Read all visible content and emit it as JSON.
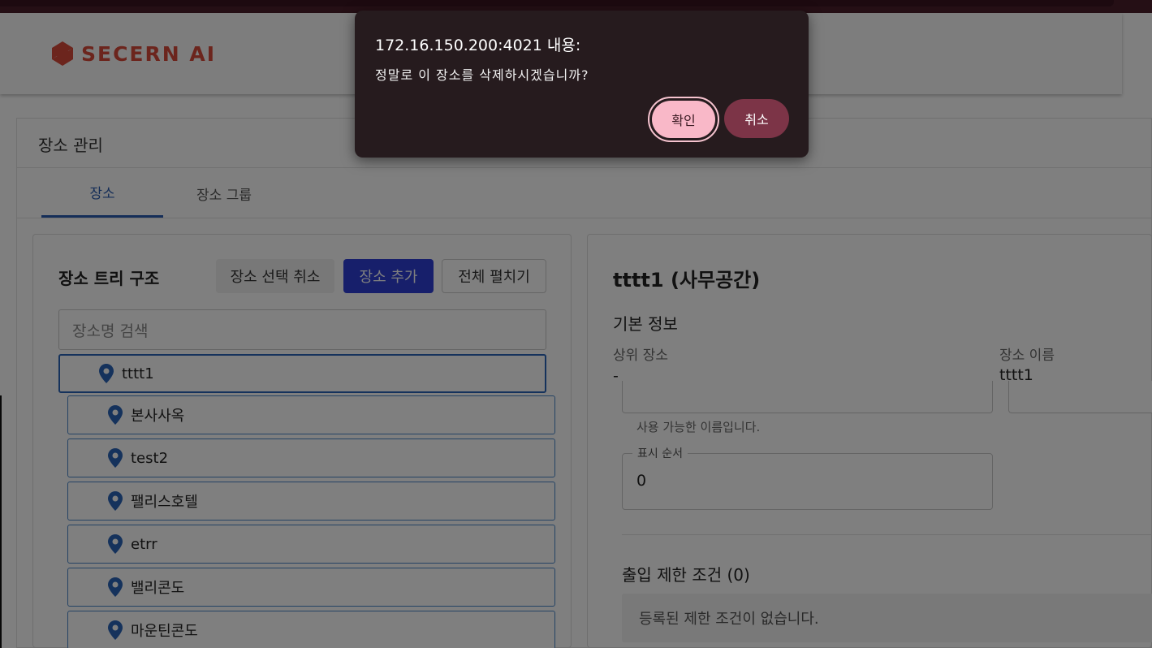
{
  "app": {
    "logo_text": "SECERN AI",
    "brand_color": "#d84a3a"
  },
  "page": {
    "title": "장소 관리",
    "tabs": [
      {
        "label": "장소",
        "active": true
      },
      {
        "label": "장소 그룹",
        "active": false
      }
    ]
  },
  "tree_panel": {
    "title": "장소 트리 구조",
    "deselect_label": "장소 선택 취소",
    "add_label": "장소 추가",
    "expand_label": "전체 펼치기",
    "search_placeholder": "장소명 검색",
    "items": [
      {
        "label": "tttt1",
        "selected": true,
        "icon": "location-pin-icon"
      },
      {
        "label": "본사사옥",
        "icon": "location-pin-icon"
      },
      {
        "label": "test2",
        "icon": "location-pin-icon"
      },
      {
        "label": "팰리스호텔",
        "icon": "location-pin-icon"
      },
      {
        "label": "etrr",
        "icon": "location-pin-icon"
      },
      {
        "label": "밸리콘도",
        "icon": "location-pin-icon"
      },
      {
        "label": "마운틴콘도",
        "icon": "location-pin-icon"
      }
    ]
  },
  "detail_panel": {
    "title": "tttt1 (사무공간)",
    "section_basic": "기본 정보",
    "parent_label": "상위 장소",
    "parent_value": "-",
    "name_label": "장소 이름",
    "name_value": "tttt1",
    "name_helper": "사용 가능한 이름입니다.",
    "order_label": "표시 순서",
    "order_value": "0",
    "restrictions_title": "출입 제한 조건 (0)",
    "restrictions_empty": "등록된 제한 조건이 없습니다."
  },
  "dialog": {
    "title": "172.16.150.200:4021 내용:",
    "message": "정말로 이 장소를 삭제하시겠습니까?",
    "ok_label": "확인",
    "cancel_label": "취소"
  }
}
